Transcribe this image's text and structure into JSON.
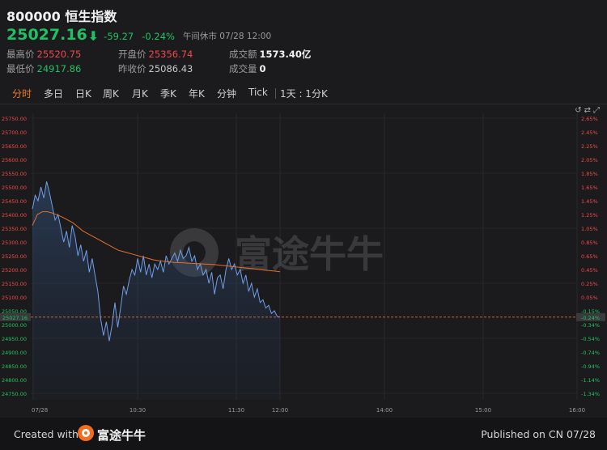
{
  "header": {
    "code": "800000",
    "name": "恒生指数",
    "price": "25027.16",
    "arrow": "⬇",
    "change": "-59.27",
    "change_pct": "-0.24%",
    "status": "午间休市 07/28 12:00"
  },
  "stats": {
    "high_label": "最高价",
    "high": "25520.75",
    "low_label": "最低价",
    "low": "24917.86",
    "open_label": "开盘价",
    "open": "25356.74",
    "prev_label": "昨收价",
    "prev": "25086.43",
    "turnover_label": "成交额",
    "turnover": "1573.40亿",
    "volume_label": "成交量",
    "volume": "0"
  },
  "tabs": [
    "分时",
    "多日",
    "日K",
    "周K",
    "月K",
    "季K",
    "年K",
    "分钟",
    "Tick"
  ],
  "tab_right": "1天 : 1分K",
  "colors": {
    "accent": "#f07a30",
    "up": "#f0494a",
    "down": "#1ec264",
    "line": "#6f9ee8",
    "avg": "#e0702e"
  },
  "watermark": "富途牛牛",
  "chart_data": {
    "type": "line",
    "x_ticks": [
      "07/28",
      "10:30",
      "11:30",
      "12:00",
      "14:00",
      "15:00",
      "16:00"
    ],
    "y_left_ticks": [
      "25750.00",
      "25700.00",
      "25650.00",
      "25600.00",
      "25550.00",
      "25500.00",
      "25450.00",
      "25400.00",
      "25350.00",
      "25300.00",
      "25250.00",
      "25200.00",
      "25150.00",
      "25100.00",
      "25050.00",
      "25000.00",
      "24950.00",
      "24900.00",
      "24850.00",
      "24800.00",
      "24750.00"
    ],
    "y_right_ticks": [
      "2.65%",
      "2.45%",
      "2.25%",
      "2.05%",
      "1.85%",
      "1.65%",
      "1.45%",
      "1.25%",
      "1.05%",
      "0.85%",
      "0.65%",
      "0.45%",
      "0.25%",
      "0.05%",
      "-0.15%",
      "-0.34%",
      "-0.54%",
      "-0.74%",
      "-0.94%",
      "-1.14%",
      "-1.34%"
    ],
    "ylim": [
      24750,
      25750
    ],
    "prev_close": 25086.43,
    "current_label": "25027.16",
    "current_pct_label": "-0.24%",
    "series": [
      {
        "role": "price",
        "values": [
          25420,
          25470,
          25450,
          25500,
          25460,
          25520,
          25480,
          25430,
          25380,
          25400,
          25350,
          25300,
          25340,
          25280,
          25360,
          25320,
          25250,
          25290,
          25230,
          25270,
          25190,
          25240,
          25180,
          25120,
          25020,
          24960,
          25010,
          24940,
          25000,
          25080,
          24990,
          25060,
          25140,
          25110,
          25160,
          25200,
          25180,
          25240,
          25190,
          25250,
          25180,
          25220,
          25170,
          25220,
          25200,
          25230,
          25190,
          25250,
          25220,
          25240,
          25260,
          25230,
          25270,
          25240,
          25250,
          25280,
          25230,
          25250,
          25200,
          25220,
          25180,
          25200,
          25150,
          25190,
          25110,
          25170,
          25180,
          25130,
          25200,
          25240,
          25200,
          25220,
          25180,
          25200,
          25150,
          25180,
          25120,
          25150,
          25100,
          25130,
          25080,
          25090,
          25060,
          25070,
          25040,
          25050,
          25030,
          25027
        ]
      },
      {
        "role": "average",
        "values": [
          25360,
          25400,
          25410,
          25410,
          25405,
          25398,
          25390,
          25380,
          25370,
          25355,
          25340,
          25330,
          25320,
          25310,
          25300,
          25290,
          25280,
          25270,
          25265,
          25260,
          25255,
          25250,
          25245,
          25240,
          25235,
          25232,
          25230,
          25228,
          25226,
          25225,
          25224,
          25223,
          25222,
          25221,
          25220,
          25219,
          25218,
          25216,
          25214,
          25212,
          25210,
          25208,
          25206,
          25204,
          25202,
          25200,
          25198,
          25196,
          25194,
          25192
        ]
      }
    ]
  },
  "footer": {
    "created_with": "Created with",
    "brand": "富途牛牛",
    "published": "Published on CN 07/28"
  }
}
